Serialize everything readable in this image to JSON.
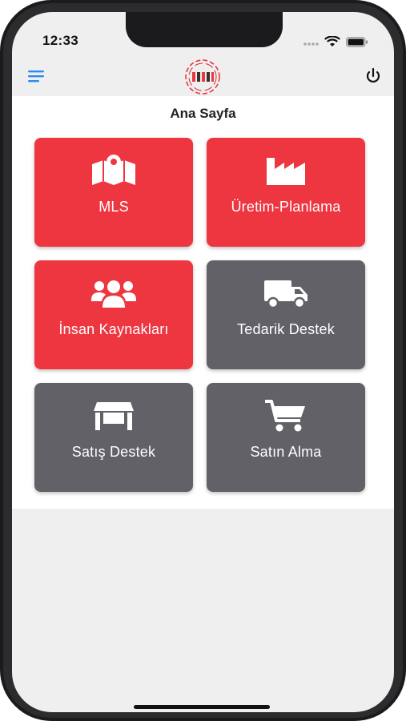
{
  "status_bar": {
    "time": "12:33"
  },
  "header": {
    "menu_icon": "hamburger-menu-icon",
    "logo_icon": "company-logo",
    "power_icon": "power-icon"
  },
  "page": {
    "title": "Ana Sayfa"
  },
  "tiles": [
    {
      "label": "MLS",
      "icon": "map-marker-icon",
      "color": "#ee3641"
    },
    {
      "label": "Üretim-Planlama",
      "icon": "factory-icon",
      "color": "#ee3641"
    },
    {
      "label": "İnsan Kaynakları",
      "icon": "users-icon",
      "color": "#ee3641"
    },
    {
      "label": "Tedarik Destek",
      "icon": "truck-icon",
      "color": "#616167"
    },
    {
      "label": "Satış Destek",
      "icon": "store-icon",
      "color": "#616167"
    },
    {
      "label": "Satın Alma",
      "icon": "cart-icon",
      "color": "#616167"
    }
  ],
  "colors": {
    "accent_red": "#ee3641",
    "tile_gray": "#616167",
    "menu_blue": "#2a8cf0"
  }
}
